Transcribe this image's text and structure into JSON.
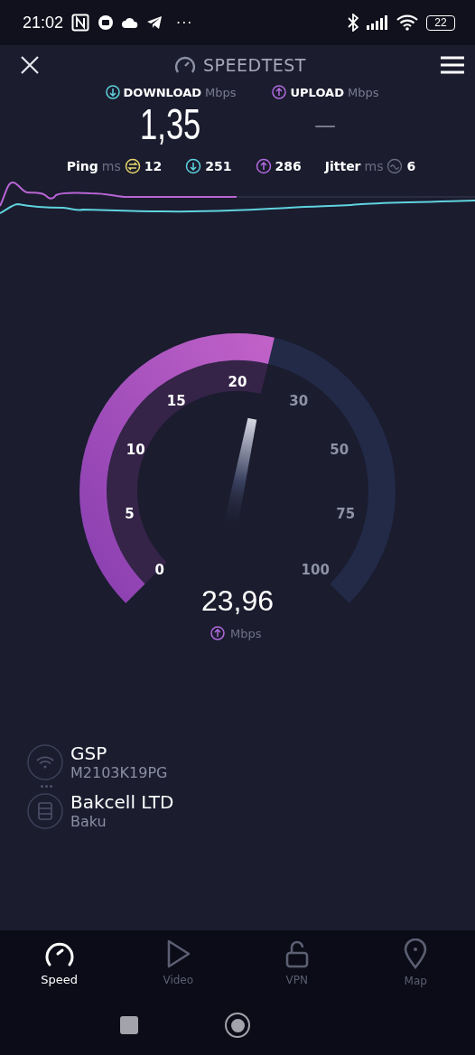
{
  "status_bar": {
    "time": "21:02",
    "more": "···",
    "battery": "22"
  },
  "header": {
    "title": "SPEEDTEST"
  },
  "results": [
    {
      "kind": "download",
      "label": "DOWNLOAD",
      "unit": "Mbps",
      "value": "1,35"
    },
    {
      "kind": "upload",
      "label": "UPLOAD",
      "unit": "Mbps",
      "value": "—"
    }
  ],
  "stats": [
    {
      "kind": "ping",
      "label": "Ping",
      "unit": "ms",
      "value": "12"
    },
    {
      "kind": "download",
      "value": "251"
    },
    {
      "kind": "upload",
      "value": "286"
    },
    {
      "kind": "jitter",
      "label": "Jitter",
      "unit": "ms",
      "value": "6"
    }
  ],
  "gauge": {
    "reading": "23,96",
    "unit": "Mbps",
    "ticks": [
      {
        "label": "0",
        "passed": true
      },
      {
        "label": "5",
        "passed": true
      },
      {
        "label": "10",
        "passed": true
      },
      {
        "label": "15",
        "passed": true
      },
      {
        "label": "20",
        "passed": true
      },
      {
        "label": "30",
        "passed": false
      },
      {
        "label": "50",
        "passed": false
      },
      {
        "label": "75",
        "passed": false
      },
      {
        "label": "100",
        "passed": false
      }
    ]
  },
  "connection": [
    {
      "kind": "wifi",
      "name": "GSP",
      "detail": "M2103K19PG"
    },
    {
      "kind": "server",
      "name": "Bakcell LTD",
      "detail": "Baku"
    }
  ],
  "nav": [
    {
      "kind": "speed",
      "label": "Speed",
      "selected": true
    },
    {
      "kind": "video",
      "label": "Video",
      "selected": false
    },
    {
      "kind": "vpn",
      "label": "VPN",
      "selected": false
    },
    {
      "kind": "map",
      "label": "Map",
      "selected": false
    }
  ]
}
